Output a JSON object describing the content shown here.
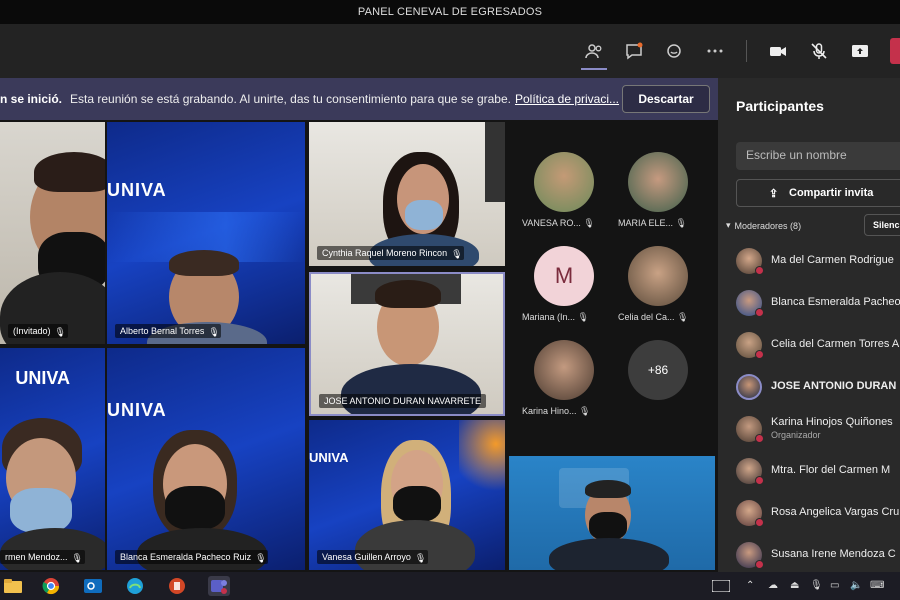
{
  "window": {
    "title": "PANEL CENEVAL DE EGRESADOS"
  },
  "banner": {
    "bold": "n se inició.",
    "text": "Esta reunión se está grabando. Al unirte, das tu consentimiento para que se grabe.",
    "link": "Política de privaci...",
    "dismiss": "Descartar"
  },
  "tiles": [
    {
      "name": "(Invitado)"
    },
    {
      "name": "Alberto Bernal Torres",
      "logo": "UNIVA"
    },
    {
      "name": "Cynthia Raquel Moreno Rincon"
    },
    {
      "name": "JOSE ANTONIO DURAN NAVARRETE"
    },
    {
      "name": "rmen Mendoz...",
      "logo": "UNIVA"
    },
    {
      "name": "Blanca Esmeralda Pacheco Ruiz",
      "logo": "UNIVA"
    },
    {
      "name": "Vanesa Guillen Arroyo",
      "logo": "UNIVA"
    },
    {
      "name": ""
    }
  ],
  "avatar_grid": [
    {
      "name": "VANESA RO..."
    },
    {
      "name": "MARIA ELE..."
    },
    {
      "name": "Mariana (In...",
      "initial": "M"
    },
    {
      "name": "Celia del Ca..."
    },
    {
      "name": "Karina Hino..."
    },
    {
      "more": "+86"
    }
  ],
  "participants": {
    "title": "Participantes",
    "search_placeholder": "Escribe un nombre",
    "share_label": "Compartir invita",
    "section": "Moderadores (8)",
    "silence": "Silenc",
    "people": [
      {
        "name": "Ma del Carmen Rodrigue"
      },
      {
        "name": "Blanca Esmeralda Pacheo"
      },
      {
        "name": "Celia del Carmen Torres A"
      },
      {
        "name": "JOSE ANTONIO DURAN"
      },
      {
        "name": "Karina Hinojos Quiñones",
        "role": "Organizador"
      },
      {
        "name": "Mtra. Flor del Carmen M"
      },
      {
        "name": "Rosa Angelica Vargas Cru"
      },
      {
        "name": "Susana Irene Mendoza C"
      }
    ]
  },
  "colors": {
    "accent": "#3b3a5a",
    "leave": "#c4314b",
    "panel": "#292929"
  }
}
